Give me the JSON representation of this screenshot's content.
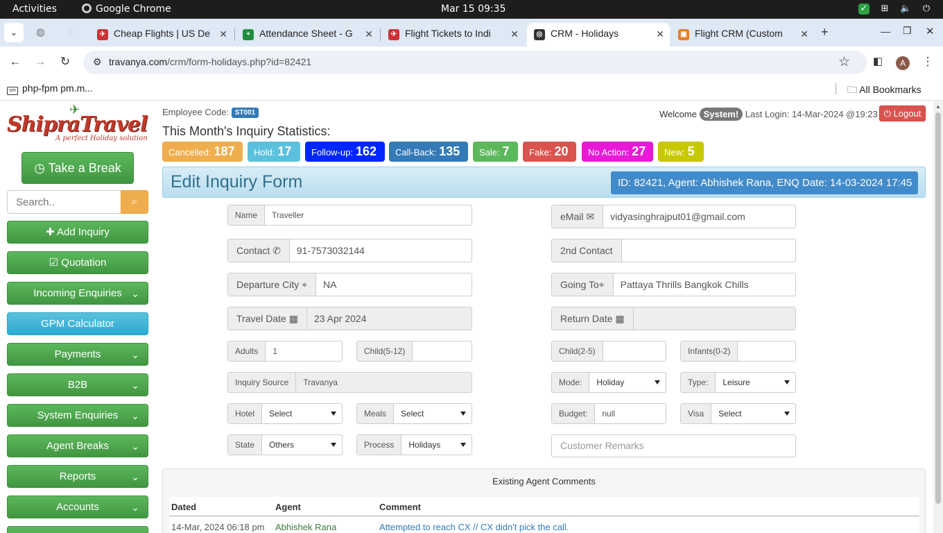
{
  "os_bar": {
    "activities": "Activities",
    "app_name": "Google Chrome",
    "clock": "Mar 15  09:35"
  },
  "tabs": [
    {
      "title": "Cheap Flights | US De",
      "fav": "travel"
    },
    {
      "title": "Attendance Sheet - G",
      "fav": "sheets"
    },
    {
      "title": "Flight Tickets to Indi",
      "fav": "travel"
    },
    {
      "title": "CRM - Holidays",
      "fav": "crm",
      "active": true
    },
    {
      "title": "Flight CRM (Custom",
      "fav": "crm2"
    }
  ],
  "address": {
    "host": "travanya.com",
    "path": "/crm/form-holidays.php?id=82421"
  },
  "profile_initial": "A",
  "bookmarks": {
    "item": "php-fpm pm.m...",
    "all": "All Bookmarks"
  },
  "logo": {
    "brand": "ShipraTravel",
    "tagline": "A perfect Holiday solution"
  },
  "sidebar": {
    "break_label": "Take a Break",
    "search_placeholder": "Search..",
    "items": [
      {
        "label": "Add Inquiry",
        "icon": "plus-icon"
      },
      {
        "label": "Quotation",
        "icon": "edit-icon"
      },
      {
        "label": "Incoming Enquiries",
        "dropdown": true
      },
      {
        "label": "GPM Calculator"
      },
      {
        "label": "Payments",
        "dropdown": true
      },
      {
        "label": "B2B",
        "dropdown": true
      },
      {
        "label": "System Enquiries",
        "dropdown": true
      },
      {
        "label": "Agent Breaks",
        "dropdown": true
      },
      {
        "label": "Reports",
        "dropdown": true
      },
      {
        "label": "Accounts",
        "dropdown": true
      }
    ]
  },
  "header": {
    "employee_code_label": "Employee Code:",
    "employee_code": "ST001",
    "welcome": "Welcome",
    "user": "System!",
    "last_login": "Last Login: 14-Mar-2024 @19:23",
    "logout": "Logout"
  },
  "stats": {
    "title": "This Month's Inquiry Statistics:",
    "items": [
      {
        "label": "Cancelled:",
        "value": "187",
        "color": "#f0ad4e"
      },
      {
        "label": "Hold:",
        "value": "17",
        "color": "#5bc0de"
      },
      {
        "label": "Follow-up:",
        "value": "162",
        "color": "#0026ff"
      },
      {
        "label": "Call-Back:",
        "value": "135",
        "color": "#337ab7"
      },
      {
        "label": "Sale:",
        "value": "7",
        "color": "#5cb85c"
      },
      {
        "label": "Fake:",
        "value": "20",
        "color": "#d9534f"
      },
      {
        "label": "No Action:",
        "value": "27",
        "color": "#e81ad8"
      },
      {
        "label": "New:",
        "value": "5",
        "color": "#c8c800"
      }
    ]
  },
  "form": {
    "title": "Edit Inquiry Form",
    "id_info": "ID: 82421, Agent: Abhishek Rana, ENQ Date: 14-03-2024 17:45",
    "name_label": "Name",
    "name": "Traveller",
    "email_label": "eMail",
    "email": "vidyasinghrajput01@gmail.com",
    "contact_label": "Contact",
    "contact": "91-7573032144",
    "contact2_label": "2nd Contact",
    "contact2": "",
    "departure_label": "Departure City",
    "departure": "NA",
    "going_label": "Going To",
    "going": "Pattaya Thrills Bangkok Chills",
    "travel_date_label": "Travel Date",
    "travel_date": "23 Apr 2024",
    "return_date_label": "Return Date",
    "return_date": "",
    "adults_label": "Adults",
    "adults": "1",
    "child512_label": "Child(5-12)",
    "child512": "",
    "child25_label": "Child(2-5)",
    "child25": "",
    "infants_label": "Infants(0-2)",
    "infants": "",
    "source_label": "Inquiry Source",
    "source": "Travanya",
    "mode_label": "Mode:",
    "mode": "Holiday",
    "type_label": "Type:",
    "type": "Leisure",
    "hotel_label": "Hotel",
    "hotel": "Select",
    "meals_label": "Meals",
    "meals": "Select",
    "budget_label": "Budget:",
    "budget": "null",
    "visa_label": "Visa",
    "visa": "Select",
    "state_label": "State",
    "state": "Others",
    "process_label": "Process",
    "process": "Holidays",
    "remarks_placeholder": "Customer Remarks"
  },
  "comments": {
    "title": "Existing Agent Comments",
    "headers": [
      "Dated",
      "Agent",
      "Comment"
    ],
    "rows": [
      {
        "dated": "14-Mar, 2024 06:18 pm",
        "agent": "Abhishek Rana",
        "comment": "Attempted to reach CX // CX didn't pick the call."
      }
    ]
  }
}
